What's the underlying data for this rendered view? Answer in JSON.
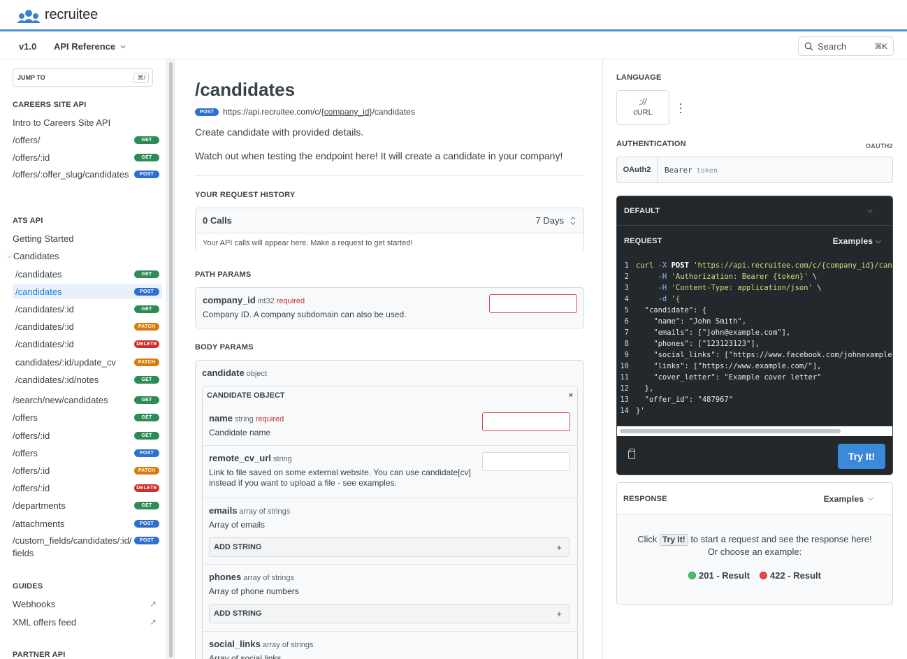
{
  "brand": {
    "name": "recruitee"
  },
  "subnav": {
    "version": "v1.0",
    "section": "API Reference",
    "search": "Search",
    "search_kbd": "⌘K"
  },
  "sidebar": {
    "jump_label": "JUMP TO",
    "jump_kbd": "⌘/",
    "sections": [
      {
        "title": "CAREERS SITE API"
      },
      {
        "title": "ATS API"
      },
      {
        "title": "GUIDES"
      },
      {
        "title": "PARTNER API"
      }
    ],
    "careers": [
      {
        "label": "Intro to Careers Site API",
        "method": ""
      },
      {
        "label": "/offers/",
        "method": "GET"
      },
      {
        "label": "/offers/:id",
        "method": "GET"
      },
      {
        "label": "/offers/:offer_slug/candidates",
        "method": "POST"
      }
    ],
    "ats_top": [
      {
        "label": "Getting Started"
      },
      {
        "label": "Candidates"
      }
    ],
    "candidates": [
      {
        "label": "/candidates",
        "method": "GET"
      },
      {
        "label": "/candidates",
        "method": "POST"
      },
      {
        "label": "/candidates/:id",
        "method": "GET"
      },
      {
        "label": "/candidates/:id",
        "method": "PATCH"
      },
      {
        "label": "/candidates/:id",
        "method": "DELETE"
      },
      {
        "label": "candidates/:id/update_cv",
        "method": "PATCH"
      },
      {
        "label": "/candidates/:id/notes",
        "method": "GET"
      }
    ],
    "ats_rest": [
      {
        "label": "/search/new/candidates",
        "method": "GET"
      },
      {
        "label": "/offers",
        "method": "GET"
      },
      {
        "label": "/offers/:id",
        "method": "GET"
      },
      {
        "label": "/offers",
        "method": "POST"
      },
      {
        "label": "/offers/:id",
        "method": "PATCH"
      },
      {
        "label": "/offers/:id",
        "method": "DELETE"
      },
      {
        "label": "/departments",
        "method": "GET"
      },
      {
        "label": "/attachments",
        "method": "POST"
      },
      {
        "label": "/custom_fields/candidates/:id/fields",
        "method": "POST"
      }
    ],
    "guides": [
      {
        "label": "Webhooks"
      },
      {
        "label": "XML offers feed"
      }
    ]
  },
  "main": {
    "title": "/candidates",
    "method": "POST",
    "url_prefix": "https://api.recruitee.com/c/",
    "url_param": "{company_id}",
    "url_suffix": "/candidates",
    "desc1": "Create candidate with provided details.",
    "desc2": "Watch out when testing the endpoint here! It will create a candidate in your company!",
    "history": {
      "heading": "YOUR REQUEST HISTORY",
      "calls": "0 Calls",
      "range": "7 Days",
      "empty": "Your API calls will appear here. Make a request to get started!"
    },
    "path_params": {
      "heading": "PATH PARAMS",
      "name": "company_id",
      "type": "int32",
      "required": "required",
      "desc": "Company ID. A company subdomain can also be used."
    },
    "body_params": {
      "heading": "BODY PARAMS",
      "name": "candidate",
      "type": "object",
      "object_title": "CANDIDATE OBJECT",
      "close": "×",
      "fields": [
        {
          "name": "name",
          "type": "string",
          "required": "required",
          "desc": "Candidate name"
        },
        {
          "name": "remote_cv_url",
          "type": "string",
          "required": "",
          "desc": "Link to file saved on some external website. You can use candidate[cv] instead if you want to upload a file - see examples."
        },
        {
          "name": "emails",
          "type": "array of strings",
          "required": "",
          "desc": "Array of emails"
        },
        {
          "name": "phones",
          "type": "array of strings",
          "required": "",
          "desc": "Array of phone numbers"
        },
        {
          "name": "social_links",
          "type": "array of strings",
          "required": "",
          "desc": "Array of social links"
        }
      ],
      "add_string": "ADD STRING",
      "plus": "+"
    }
  },
  "right": {
    "language_heading": "LANGUAGE",
    "language_symbol": "://",
    "language": "cURL",
    "auth_heading": "AUTHENTICATION",
    "auth_type": "OAUTH2",
    "auth_label": "OAuth2",
    "auth_scheme": "Bearer",
    "auth_placeholder": "token",
    "code_default": "DEFAULT",
    "code_request": "REQUEST",
    "code_examples": "Examples",
    "try_it": "Try It!",
    "response_heading": "RESPONSE",
    "response_examples": "Examples",
    "response_text1": "Click",
    "response_btn": "Try It!",
    "response_text2": "to start a request and see the response here!",
    "response_text3": "Or choose an example:",
    "example_ok": "201 - Result",
    "example_err": "422 - Result",
    "colors": {
      "accent": "#3a8ad9",
      "ok": "#3cc46a",
      "err": "#e5484d"
    }
  }
}
